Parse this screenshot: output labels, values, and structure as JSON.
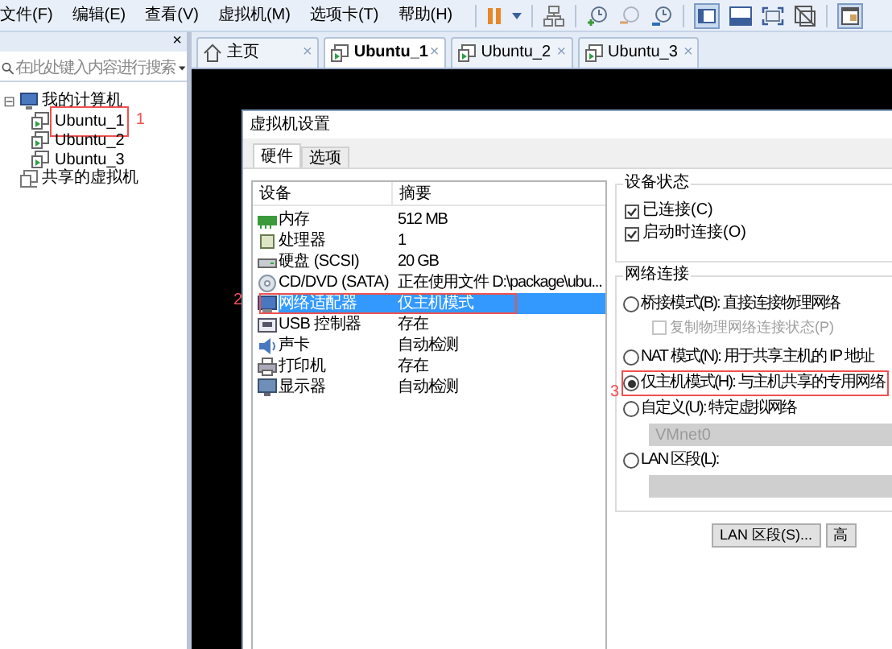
{
  "menu": [
    "文件(F)",
    "编辑(E)",
    "查看(V)",
    "虚拟机(M)",
    "选项卡(T)",
    "帮助(H)"
  ],
  "sidebar": {
    "close": "×",
    "search": {
      "placeholder": "在此处键入内容进行搜索"
    },
    "tree": [
      {
        "label": "我的计算机",
        "kind": "computer",
        "expanded": true,
        "toggle": "⊟",
        "children": [
          {
            "label": "Ubuntu_1",
            "kind": "vm",
            "annotation": "1"
          },
          {
            "label": "Ubuntu_2",
            "kind": "vm"
          },
          {
            "label": "Ubuntu_3",
            "kind": "vm"
          }
        ]
      },
      {
        "label": "共享的虚拟机",
        "kind": "shared"
      }
    ]
  },
  "tabs": [
    {
      "label": "主页",
      "kind": "home",
      "selected": false,
      "close": "×"
    },
    {
      "label": "Ubuntu_1",
      "kind": "vm",
      "selected": true,
      "close": "×"
    },
    {
      "label": "Ubuntu_2",
      "kind": "vm",
      "selected": false,
      "close": "×"
    },
    {
      "label": "Ubuntu_3",
      "kind": "vm",
      "selected": false,
      "close": "×"
    }
  ],
  "dialog": {
    "title": "虚拟机设置",
    "tabs": [
      {
        "label": "硬件",
        "selected": true
      },
      {
        "label": "选项",
        "selected": false
      }
    ],
    "columns": [
      "设备",
      "摘要"
    ],
    "devices": [
      {
        "kind": "memory",
        "device": "内存",
        "summary": "512 MB",
        "selected": false
      },
      {
        "kind": "cpu",
        "device": "处理器",
        "summary": "1",
        "selected": false
      },
      {
        "kind": "disk",
        "device": "硬盘 (SCSI)",
        "summary": "20 GB",
        "selected": false
      },
      {
        "kind": "cd",
        "device": "CD/DVD (SATA)",
        "summary": "正在使用文件 D:\\package\\ubu...",
        "selected": false
      },
      {
        "kind": "network",
        "device": "网络适配器",
        "summary": "仅主机模式",
        "selected": true,
        "annotation": "2"
      },
      {
        "kind": "usb",
        "device": "USB 控制器",
        "summary": "存在",
        "selected": false
      },
      {
        "kind": "sound",
        "device": "声卡",
        "summary": "自动检测",
        "selected": false
      },
      {
        "kind": "printer",
        "device": "打印机",
        "summary": "存在",
        "selected": false
      },
      {
        "kind": "display",
        "device": "显示器",
        "summary": "自动检测",
        "selected": false
      }
    ],
    "device_status": {
      "title": "设备状态",
      "checks": [
        {
          "label": "已连接(C)",
          "checked": true
        },
        {
          "label": "启动时连接(O)",
          "checked": true
        }
      ]
    },
    "network": {
      "title": "网络连接",
      "options": [
        {
          "kind": "radio",
          "label": "桥接模式(B): 直接连接物理网络",
          "selected": false
        },
        {
          "kind": "checkbox",
          "label": "复制物理网络连接状态(P)",
          "checked": false,
          "disabled": true
        },
        {
          "kind": "radio",
          "label": "NAT 模式(N): 用于共享主机的 IP 地址",
          "selected": false
        },
        {
          "kind": "radio",
          "label": "仅主机模式(H): 与主机共享的专用网络",
          "selected": true,
          "annotation": "3"
        },
        {
          "kind": "radio",
          "label": "自定义(U): 特定虚拟网络",
          "selected": false
        },
        {
          "kind": "select",
          "value": "VMnet0",
          "disabled": true
        },
        {
          "kind": "radio",
          "label": "LAN 区段(L):",
          "selected": false
        },
        {
          "kind": "select",
          "disabled": true
        }
      ]
    },
    "buttons": [
      "LAN 区段(S)...",
      "高"
    ]
  }
}
